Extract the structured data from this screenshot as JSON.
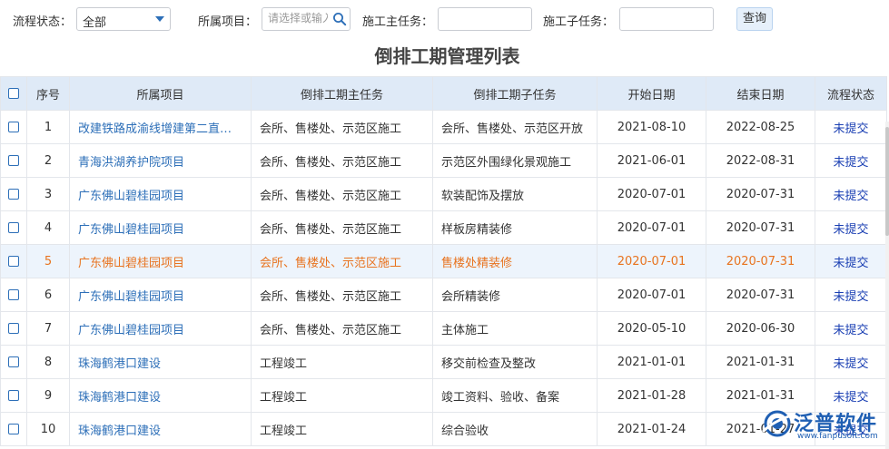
{
  "filters": {
    "status_label": "流程状态：",
    "status_value": "全部",
    "project_label": "所属项目：",
    "project_placeholder": "请选择或输入",
    "main_task_label": "施工主任务：",
    "main_task_value": "",
    "sub_task_label": "施工子任务：",
    "sub_task_value": "",
    "query_label": "查询"
  },
  "page_title": "倒排工期管理列表",
  "table": {
    "columns": [
      "序号",
      "所属项目",
      "倒排工期主任务",
      "倒排工期子任务",
      "开始日期",
      "结束日期",
      "流程状态"
    ],
    "rows": [
      {
        "no": "1",
        "project": "改建铁路成渝线增建第二直通线",
        "main_task": "会所、售楼处、示范区施工",
        "sub_task": "会所、售楼处、示范区开放",
        "start": "2021-08-10",
        "end": "2022-08-25",
        "status": "未提交"
      },
      {
        "no": "2",
        "project": "青海洪湖养护院项目",
        "main_task": "会所、售楼处、示范区施工",
        "sub_task": "示范区外围绿化景观施工",
        "start": "2021-06-01",
        "end": "2022-08-31",
        "status": "未提交"
      },
      {
        "no": "3",
        "project": "广东佛山碧桂园项目",
        "main_task": "会所、售楼处、示范区施工",
        "sub_task": "软装配饰及摆放",
        "start": "2020-07-01",
        "end": "2020-07-31",
        "status": "未提交"
      },
      {
        "no": "4",
        "project": "广东佛山碧桂园项目",
        "main_task": "会所、售楼处、示范区施工",
        "sub_task": "样板房精装修",
        "start": "2020-07-01",
        "end": "2020-07-31",
        "status": "未提交"
      },
      {
        "no": "5",
        "project": "广东佛山碧桂园项目",
        "main_task": "会所、售楼处、示范区施工",
        "sub_task": "售楼处精装修",
        "start": "2020-07-01",
        "end": "2020-07-31",
        "status": "未提交",
        "highlighted": true
      },
      {
        "no": "6",
        "project": "广东佛山碧桂园项目",
        "main_task": "会所、售楼处、示范区施工",
        "sub_task": "会所精装修",
        "start": "2020-07-01",
        "end": "2020-07-31",
        "status": "未提交"
      },
      {
        "no": "7",
        "project": "广东佛山碧桂园项目",
        "main_task": "会所、售楼处、示范区施工",
        "sub_task": "主体施工",
        "start": "2020-05-10",
        "end": "2020-06-30",
        "status": "未提交"
      },
      {
        "no": "8",
        "project": "珠海鹤港口建设",
        "main_task": "工程竣工",
        "sub_task": "移交前检查及整改",
        "start": "2021-01-01",
        "end": "2021-01-31",
        "status": "未提交"
      },
      {
        "no": "9",
        "project": "珠海鹤港口建设",
        "main_task": "工程竣工",
        "sub_task": "竣工资料、验收、备案",
        "start": "2021-01-28",
        "end": "2021-01-31",
        "status": "未提交"
      },
      {
        "no": "10",
        "project": "珠海鹤港口建设",
        "main_task": "工程竣工",
        "sub_task": "综合验收",
        "start": "2021-01-24",
        "end": "2021-01-27",
        "status": "未提交"
      }
    ]
  },
  "logo": {
    "text": "泛普软件",
    "url": "www.fanpusoft.com",
    "brand_color": "#1f5fb3"
  },
  "colors": {
    "link": "#2d6fb8",
    "status": "#1a3fb3",
    "highlight_text": "#e8731f",
    "header_bg": "#dfeaf7"
  }
}
